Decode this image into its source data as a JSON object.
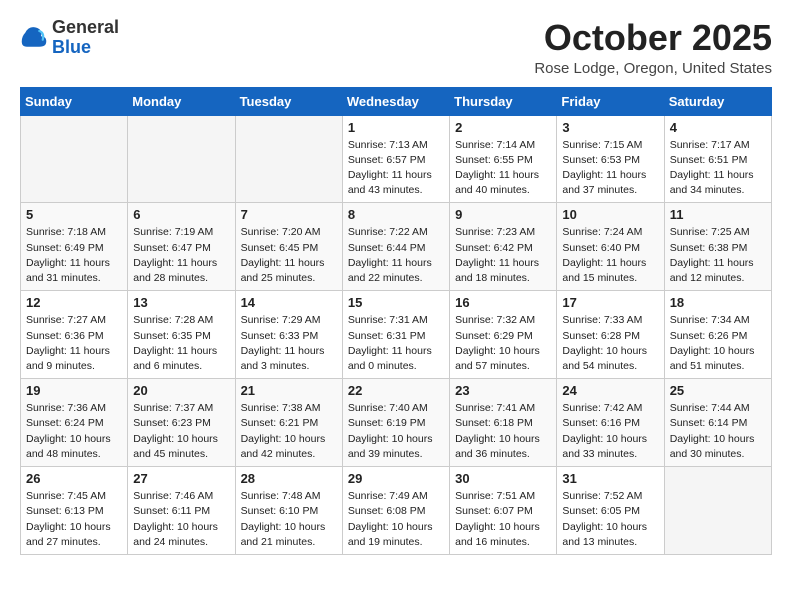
{
  "logo": {
    "general": "General",
    "blue": "Blue"
  },
  "title": "October 2025",
  "location": "Rose Lodge, Oregon, United States",
  "weekdays": [
    "Sunday",
    "Monday",
    "Tuesday",
    "Wednesday",
    "Thursday",
    "Friday",
    "Saturday"
  ],
  "weeks": [
    [
      {
        "day": "",
        "empty": true
      },
      {
        "day": "",
        "empty": true
      },
      {
        "day": "",
        "empty": true
      },
      {
        "day": "1",
        "sunrise": "7:13 AM",
        "sunset": "6:57 PM",
        "daylight": "11 hours and 43 minutes."
      },
      {
        "day": "2",
        "sunrise": "7:14 AM",
        "sunset": "6:55 PM",
        "daylight": "11 hours and 40 minutes."
      },
      {
        "day": "3",
        "sunrise": "7:15 AM",
        "sunset": "6:53 PM",
        "daylight": "11 hours and 37 minutes."
      },
      {
        "day": "4",
        "sunrise": "7:17 AM",
        "sunset": "6:51 PM",
        "daylight": "11 hours and 34 minutes."
      }
    ],
    [
      {
        "day": "5",
        "sunrise": "7:18 AM",
        "sunset": "6:49 PM",
        "daylight": "11 hours and 31 minutes."
      },
      {
        "day": "6",
        "sunrise": "7:19 AM",
        "sunset": "6:47 PM",
        "daylight": "11 hours and 28 minutes."
      },
      {
        "day": "7",
        "sunrise": "7:20 AM",
        "sunset": "6:45 PM",
        "daylight": "11 hours and 25 minutes."
      },
      {
        "day": "8",
        "sunrise": "7:22 AM",
        "sunset": "6:44 PM",
        "daylight": "11 hours and 22 minutes."
      },
      {
        "day": "9",
        "sunrise": "7:23 AM",
        "sunset": "6:42 PM",
        "daylight": "11 hours and 18 minutes."
      },
      {
        "day": "10",
        "sunrise": "7:24 AM",
        "sunset": "6:40 PM",
        "daylight": "11 hours and 15 minutes."
      },
      {
        "day": "11",
        "sunrise": "7:25 AM",
        "sunset": "6:38 PM",
        "daylight": "11 hours and 12 minutes."
      }
    ],
    [
      {
        "day": "12",
        "sunrise": "7:27 AM",
        "sunset": "6:36 PM",
        "daylight": "11 hours and 9 minutes."
      },
      {
        "day": "13",
        "sunrise": "7:28 AM",
        "sunset": "6:35 PM",
        "daylight": "11 hours and 6 minutes."
      },
      {
        "day": "14",
        "sunrise": "7:29 AM",
        "sunset": "6:33 PM",
        "daylight": "11 hours and 3 minutes."
      },
      {
        "day": "15",
        "sunrise": "7:31 AM",
        "sunset": "6:31 PM",
        "daylight": "11 hours and 0 minutes."
      },
      {
        "day": "16",
        "sunrise": "7:32 AM",
        "sunset": "6:29 PM",
        "daylight": "10 hours and 57 minutes."
      },
      {
        "day": "17",
        "sunrise": "7:33 AM",
        "sunset": "6:28 PM",
        "daylight": "10 hours and 54 minutes."
      },
      {
        "day": "18",
        "sunrise": "7:34 AM",
        "sunset": "6:26 PM",
        "daylight": "10 hours and 51 minutes."
      }
    ],
    [
      {
        "day": "19",
        "sunrise": "7:36 AM",
        "sunset": "6:24 PM",
        "daylight": "10 hours and 48 minutes."
      },
      {
        "day": "20",
        "sunrise": "7:37 AM",
        "sunset": "6:23 PM",
        "daylight": "10 hours and 45 minutes."
      },
      {
        "day": "21",
        "sunrise": "7:38 AM",
        "sunset": "6:21 PM",
        "daylight": "10 hours and 42 minutes."
      },
      {
        "day": "22",
        "sunrise": "7:40 AM",
        "sunset": "6:19 PM",
        "daylight": "10 hours and 39 minutes."
      },
      {
        "day": "23",
        "sunrise": "7:41 AM",
        "sunset": "6:18 PM",
        "daylight": "10 hours and 36 minutes."
      },
      {
        "day": "24",
        "sunrise": "7:42 AM",
        "sunset": "6:16 PM",
        "daylight": "10 hours and 33 minutes."
      },
      {
        "day": "25",
        "sunrise": "7:44 AM",
        "sunset": "6:14 PM",
        "daylight": "10 hours and 30 minutes."
      }
    ],
    [
      {
        "day": "26",
        "sunrise": "7:45 AM",
        "sunset": "6:13 PM",
        "daylight": "10 hours and 27 minutes."
      },
      {
        "day": "27",
        "sunrise": "7:46 AM",
        "sunset": "6:11 PM",
        "daylight": "10 hours and 24 minutes."
      },
      {
        "day": "28",
        "sunrise": "7:48 AM",
        "sunset": "6:10 PM",
        "daylight": "10 hours and 21 minutes."
      },
      {
        "day": "29",
        "sunrise": "7:49 AM",
        "sunset": "6:08 PM",
        "daylight": "10 hours and 19 minutes."
      },
      {
        "day": "30",
        "sunrise": "7:51 AM",
        "sunset": "6:07 PM",
        "daylight": "10 hours and 16 minutes."
      },
      {
        "day": "31",
        "sunrise": "7:52 AM",
        "sunset": "6:05 PM",
        "daylight": "10 hours and 13 minutes."
      },
      {
        "day": "",
        "empty": true
      }
    ]
  ]
}
